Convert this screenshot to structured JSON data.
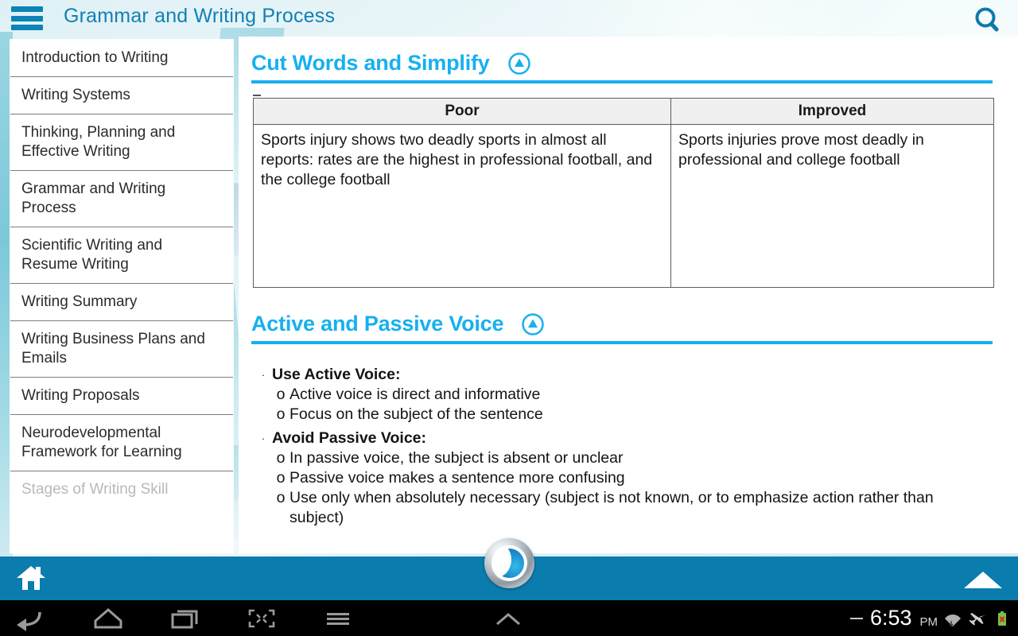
{
  "topbar": {
    "menu_icon": "hamburger-icon",
    "title": "Grammar and Writing Process",
    "search_icon": "search-icon"
  },
  "sidebar": {
    "items": [
      {
        "label": "Introduction to Writing",
        "faded": false
      },
      {
        "label": "Writing Systems",
        "faded": false
      },
      {
        "label": "Thinking, Planning and Effective Writing",
        "faded": false
      },
      {
        "label": "Grammar and Writing Process",
        "faded": false
      },
      {
        "label": "Scientific Writing and Resume Writing",
        "faded": false
      },
      {
        "label": "Writing Summary",
        "faded": false
      },
      {
        "label": "Writing Business Plans and Emails",
        "faded": false
      },
      {
        "label": "Writing  Proposals",
        "faded": false
      },
      {
        "label": "Neurodevelopmental Framework for Learning",
        "faded": false
      },
      {
        "label": "Stages of Writing Skill",
        "faded": true
      }
    ]
  },
  "content": {
    "section1": {
      "title": "Cut Words and Simplify",
      "collapse_icon": "collapse-up-icon",
      "table": {
        "headers": [
          "Poor",
          "Improved"
        ],
        "rows": [
          [
            "Sports injury shows two deadly sports in almost all reports: rates are the highest in professional football, and the college football",
            "Sports injuries prove most deadly in professional and college football"
          ]
        ]
      }
    },
    "section2": {
      "title": "Active and Passive Voice",
      "collapse_icon": "collapse-up-icon",
      "bullets": [
        {
          "mark": "·",
          "text": "Use Active Voice:",
          "sub_mark": "o",
          "subs": [
            "Active voice is direct and informative",
            "Focus on the subject of the sentence"
          ]
        },
        {
          "mark": "·",
          "text": "Avoid Passive Voice:",
          "sub_mark": "o",
          "subs": [
            "In passive voice, the subject is absent or unclear",
            "Passive voice makes a sentence more confusing",
            "Use only when absolutely necessary (subject is not known, or to emphasize action rather than subject)"
          ]
        }
      ]
    }
  },
  "appbar": {
    "home_icon": "home-icon",
    "scroll_up_icon": "up-triangle-icon",
    "brand_logo": "app-logo-icon"
  },
  "navbar": {
    "back_icon": "back-arrow-icon",
    "home_icon": "home-outline-icon",
    "recents_icon": "recent-apps-icon",
    "screenshot_icon": "screenshot-icon",
    "menu_icon": "menu-lines-icon",
    "expand_icon": "chevron-up-icon",
    "status": {
      "dash": "—",
      "time": "6:53",
      "ampm": "PM",
      "wifi_icon": "wifi-icon",
      "airplane_icon": "airplane-mode-icon",
      "battery_icon": "battery-error-icon"
    }
  },
  "colors": {
    "accent_cyan": "#16b0ef",
    "title_blue": "#1280b4",
    "appbar_blue": "#0a7cae"
  }
}
